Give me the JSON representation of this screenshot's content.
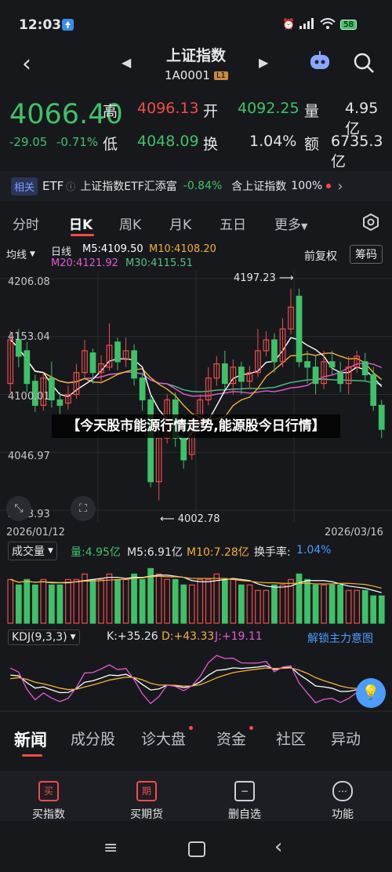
{
  "status": {
    "time": "12:03",
    "battery": "58"
  },
  "header": {
    "title": "上证指数",
    "code": "1A0001",
    "badge": "L1"
  },
  "quote": {
    "price": "4066.40",
    "change": "-29.05",
    "change_pct": "-0.71%",
    "high_label": "高",
    "high": "4096.13",
    "open_label": "开",
    "open": "4092.25",
    "vol_label": "量",
    "vol": "4.95亿",
    "low_label": "低",
    "low": "4048.09",
    "turnover_label": "换",
    "turnover": "1.04%",
    "amount_label": "额",
    "amount": "6735.3亿"
  },
  "related": {
    "tag": "相关",
    "etf": "ETF",
    "name": "上证指数ETF汇添富",
    "pct": "-0.84%",
    "contain": "含上证指数",
    "contain_pct": "100%"
  },
  "tabs": [
    "分时",
    "日K",
    "周K",
    "月K",
    "五日",
    "更多"
  ],
  "chart_header": {
    "ma_select": "均线",
    "line_label": "日线",
    "m5": "M5:4109.50",
    "m10": "M10:4108.20",
    "m20": "M20:4121.92",
    "m30": "M30:4115.51",
    "adjust": "前复权",
    "chips": "筹码"
  },
  "overlay_text": "【今天股市能源行情走势,能源股今日行情】",
  "volume_header": {
    "select": "成交量",
    "vol": "量:4.95亿",
    "m5": "M5:6.91亿",
    "m10": "M10:7.28亿",
    "turnover": "换手率:",
    "turnover_val": "1.04%"
  },
  "kdj_header": {
    "select": "KDJ(9,3,3)",
    "k": "K:+35.26",
    "d": "D:+43.33",
    "j": "J:+19.11",
    "unlock": "解锁主力意图"
  },
  "news_tabs": [
    "新闻",
    "成分股",
    "诊大盘",
    "资金",
    "社区",
    "异动"
  ],
  "bottom_nav": [
    {
      "icon": "买",
      "label": "买指数"
    },
    {
      "icon": "期",
      "label": "买期货"
    },
    {
      "icon": "−",
      "label": "删自选"
    },
    {
      "icon": "⋯",
      "label": "功能"
    }
  ],
  "colors": {
    "up": "#f04c4c",
    "down": "#3fc169",
    "bg": "#17181c",
    "m5": "#ffffff",
    "m10": "#f2b233",
    "m20": "#e15ad3",
    "m30": "#4cc489"
  },
  "chart_data": {
    "type": "candlestick",
    "y_ticks": [
      "4206.08",
      "4153.04",
      "4100.01",
      "4046.97",
      "3993.93"
    ],
    "ylim": [
      3993.93,
      4206.08
    ],
    "x_labels": [
      "2026/01/12",
      "2026/03/16"
    ],
    "high_annotation": "4197.23",
    "low_annotation": "4002.78",
    "candles": [
      {
        "o": 4110,
        "c": 4150,
        "h": 4158,
        "l": 4102
      },
      {
        "o": 4150,
        "c": 4135,
        "h": 4160,
        "l": 4125
      },
      {
        "o": 4140,
        "c": 4110,
        "h": 4148,
        "l": 4102
      },
      {
        "o": 4112,
        "c": 4090,
        "h": 4118,
        "l": 4084
      },
      {
        "o": 4090,
        "c": 4115,
        "h": 4120,
        "l": 4085
      },
      {
        "o": 4115,
        "c": 4095,
        "h": 4130,
        "l": 4088
      },
      {
        "o": 4095,
        "c": 4090,
        "h": 4102,
        "l": 4082
      },
      {
        "o": 4092,
        "c": 4100,
        "h": 4108,
        "l": 4086
      },
      {
        "o": 4100,
        "c": 4120,
        "h": 4128,
        "l": 4096
      },
      {
        "o": 4120,
        "c": 4140,
        "h": 4150,
        "l": 4115
      },
      {
        "o": 4138,
        "c": 4120,
        "h": 4142,
        "l": 4110
      },
      {
        "o": 4120,
        "c": 4128,
        "h": 4136,
        "l": 4110
      },
      {
        "o": 4125,
        "c": 4145,
        "h": 4165,
        "l": 4122
      },
      {
        "o": 4148,
        "c": 4130,
        "h": 4152,
        "l": 4122
      },
      {
        "o": 4132,
        "c": 4140,
        "h": 4152,
        "l": 4125
      },
      {
        "o": 4140,
        "c": 4115,
        "h": 4146,
        "l": 4108
      },
      {
        "o": 4115,
        "c": 4095,
        "h": 4120,
        "l": 4085
      },
      {
        "o": 4095,
        "c": 4020,
        "h": 4100,
        "l": 4015
      },
      {
        "o": 4020,
        "c": 4060,
        "h": 4068,
        "l": 4003
      },
      {
        "o": 4060,
        "c": 4095,
        "h": 4100,
        "l": 4055
      },
      {
        "o": 4095,
        "c": 4060,
        "h": 4102,
        "l": 4052
      },
      {
        "o": 4060,
        "c": 4040,
        "h": 4075,
        "l": 4032
      },
      {
        "o": 4045,
        "c": 4070,
        "h": 4078,
        "l": 4040
      },
      {
        "o": 4075,
        "c": 4095,
        "h": 4100,
        "l": 4070
      },
      {
        "o": 4095,
        "c": 4115,
        "h": 4125,
        "l": 4090
      },
      {
        "o": 4115,
        "c": 4128,
        "h": 4135,
        "l": 4108
      },
      {
        "o": 4128,
        "c": 4110,
        "h": 4140,
        "l": 4105
      },
      {
        "o": 4110,
        "c": 4125,
        "h": 4132,
        "l": 4100
      },
      {
        "o": 4125,
        "c": 4112,
        "h": 4130,
        "l": 4100
      },
      {
        "o": 4112,
        "c": 4120,
        "h": 4126,
        "l": 4105
      },
      {
        "o": 4120,
        "c": 4140,
        "h": 4160,
        "l": 4116
      },
      {
        "o": 4140,
        "c": 4150,
        "h": 4158,
        "l": 4135
      },
      {
        "o": 4150,
        "c": 4130,
        "h": 4156,
        "l": 4120
      },
      {
        "o": 4130,
        "c": 4160,
        "h": 4170,
        "l": 4125
      },
      {
        "o": 4160,
        "c": 4180,
        "h": 4197,
        "l": 4155
      },
      {
        "o": 4190,
        "c": 4130,
        "h": 4197,
        "l": 4125
      },
      {
        "o": 4130,
        "c": 4125,
        "h": 4140,
        "l": 4110
      },
      {
        "o": 4125,
        "c": 4110,
        "h": 4135,
        "l": 4100
      },
      {
        "o": 4110,
        "c": 4130,
        "h": 4140,
        "l": 4105
      },
      {
        "o": 4130,
        "c": 4125,
        "h": 4140,
        "l": 4118
      },
      {
        "o": 4120,
        "c": 4110,
        "h": 4130,
        "l": 4102
      },
      {
        "o": 4110,
        "c": 4125,
        "h": 4135,
        "l": 4100
      },
      {
        "o": 4125,
        "c": 4135,
        "h": 4140,
        "l": 4120
      },
      {
        "o": 4130,
        "c": 4118,
        "h": 4138,
        "l": 4112
      },
      {
        "o": 4118,
        "c": 4090,
        "h": 4125,
        "l": 4085
      },
      {
        "o": 4090,
        "c": 4068,
        "h": 4095,
        "l": 4060
      }
    ],
    "volume": [
      8,
      7,
      8,
      7,
      8,
      7,
      7,
      8,
      8,
      9,
      8,
      8,
      9,
      8,
      8,
      9,
      8,
      10,
      9,
      8,
      8,
      7,
      7,
      8,
      8,
      9,
      8,
      8,
      7,
      7,
      6,
      6,
      7,
      7,
      8,
      9,
      8,
      7,
      7,
      7,
      7,
      6,
      6,
      6,
      5,
      5
    ]
  }
}
